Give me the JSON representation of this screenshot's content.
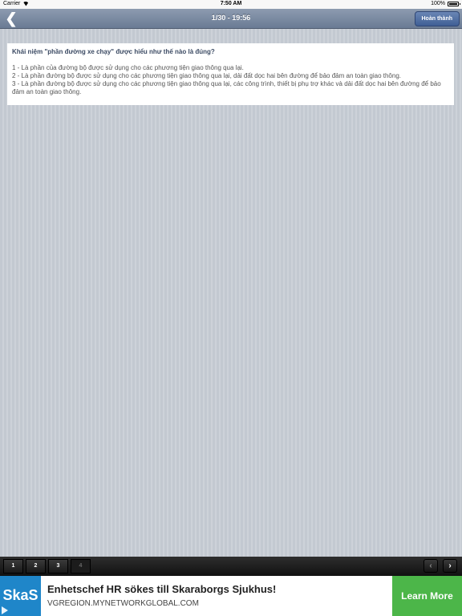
{
  "status_bar": {
    "carrier": "Carrier",
    "time": "7:50 AM",
    "battery": "100%",
    "icons": [
      "wifi-icon",
      "battery-icon"
    ]
  },
  "nav": {
    "back_glyph": "❮",
    "title": "1/30 - 19:56",
    "finish_label": "Hoàn thành",
    "accent": "#4f6fa3"
  },
  "question": {
    "text": "Khái niệm \"phần đường xe chạy\" được hiểu như thế nào là đúng?",
    "answers": [
      "1 - Là phần của đường bộ được sử dụng cho các phương tiện giao thông qua lại.",
      "2 - Là phần đường bộ được sử dụng cho các phương tiện giao thông qua lại, dải đất dọc hai bên đường để bảo đảm an toàn giao thông.",
      "3 - Là phần đường bộ được sử dụng cho các phương tiện giao thông qua lại, các công trình, thiết bị phụ trợ khác và dải đất dọc hai bên đường để bảo đảm an toàn giao thông."
    ]
  },
  "pager": {
    "pages": [
      "1",
      "2",
      "3",
      "4"
    ],
    "prev_glyph": "‹",
    "next_glyph": "›"
  },
  "ad": {
    "logo": "SkaS",
    "title": "Enhetschef HR sökes till Skaraborgs Sjukhus!",
    "url": "VGREGION.MYNETWORKGLOBAL.COM",
    "cta": "Learn More",
    "cta_color": "#4cb649",
    "logo_color": "#1f86c9"
  }
}
